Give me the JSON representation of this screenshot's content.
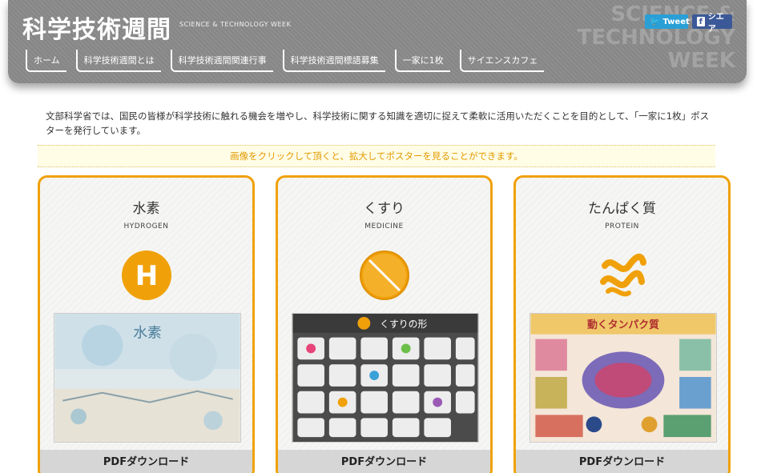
{
  "header": {
    "logo": "科学技術週間",
    "logo_sub": "SCIENCE & TECHNOLOGY WEEK",
    "watermark": [
      "SCIENCE &",
      "TECHNOLOGY",
      "WEEK"
    ],
    "tweet_label": "Tweet",
    "share_label": "シエア",
    "nav": [
      "ホーム",
      "科学技術週間とは",
      "科学技術週間関連行事",
      "科学技術週間標語募集",
      "一家に1枚",
      "サイエンスカフェ"
    ]
  },
  "intro": "文部科学省では、国民の皆様が科学技術に触れる機会を増やし、科学技術に関する知識を適切に捉えて柔軟に活用いただくことを目的として、「一家に1枚」ポスターを発行しています。",
  "notice": "画像をクリックして頂くと、拡大してポスターを見ることができます。",
  "cards": [
    {
      "title": "水素",
      "subtitle": "HYDROGEN",
      "icon_letter": "H",
      "pdf_label": "PDFダウンロード",
      "poster_title": "水素"
    },
    {
      "title": "くすり",
      "subtitle": "MEDICINE",
      "pdf_label": "PDFダウンロード",
      "poster_title": "くすりの形"
    },
    {
      "title": "たんぱく質",
      "subtitle": "PROTEIN",
      "pdf_label": "PDFダウンロード",
      "poster_title": "動くタンパク質"
    }
  ],
  "colors": {
    "accent": "#f0a10a",
    "header_bg": "#8a8a8a",
    "notice_text": "#e39a00"
  }
}
